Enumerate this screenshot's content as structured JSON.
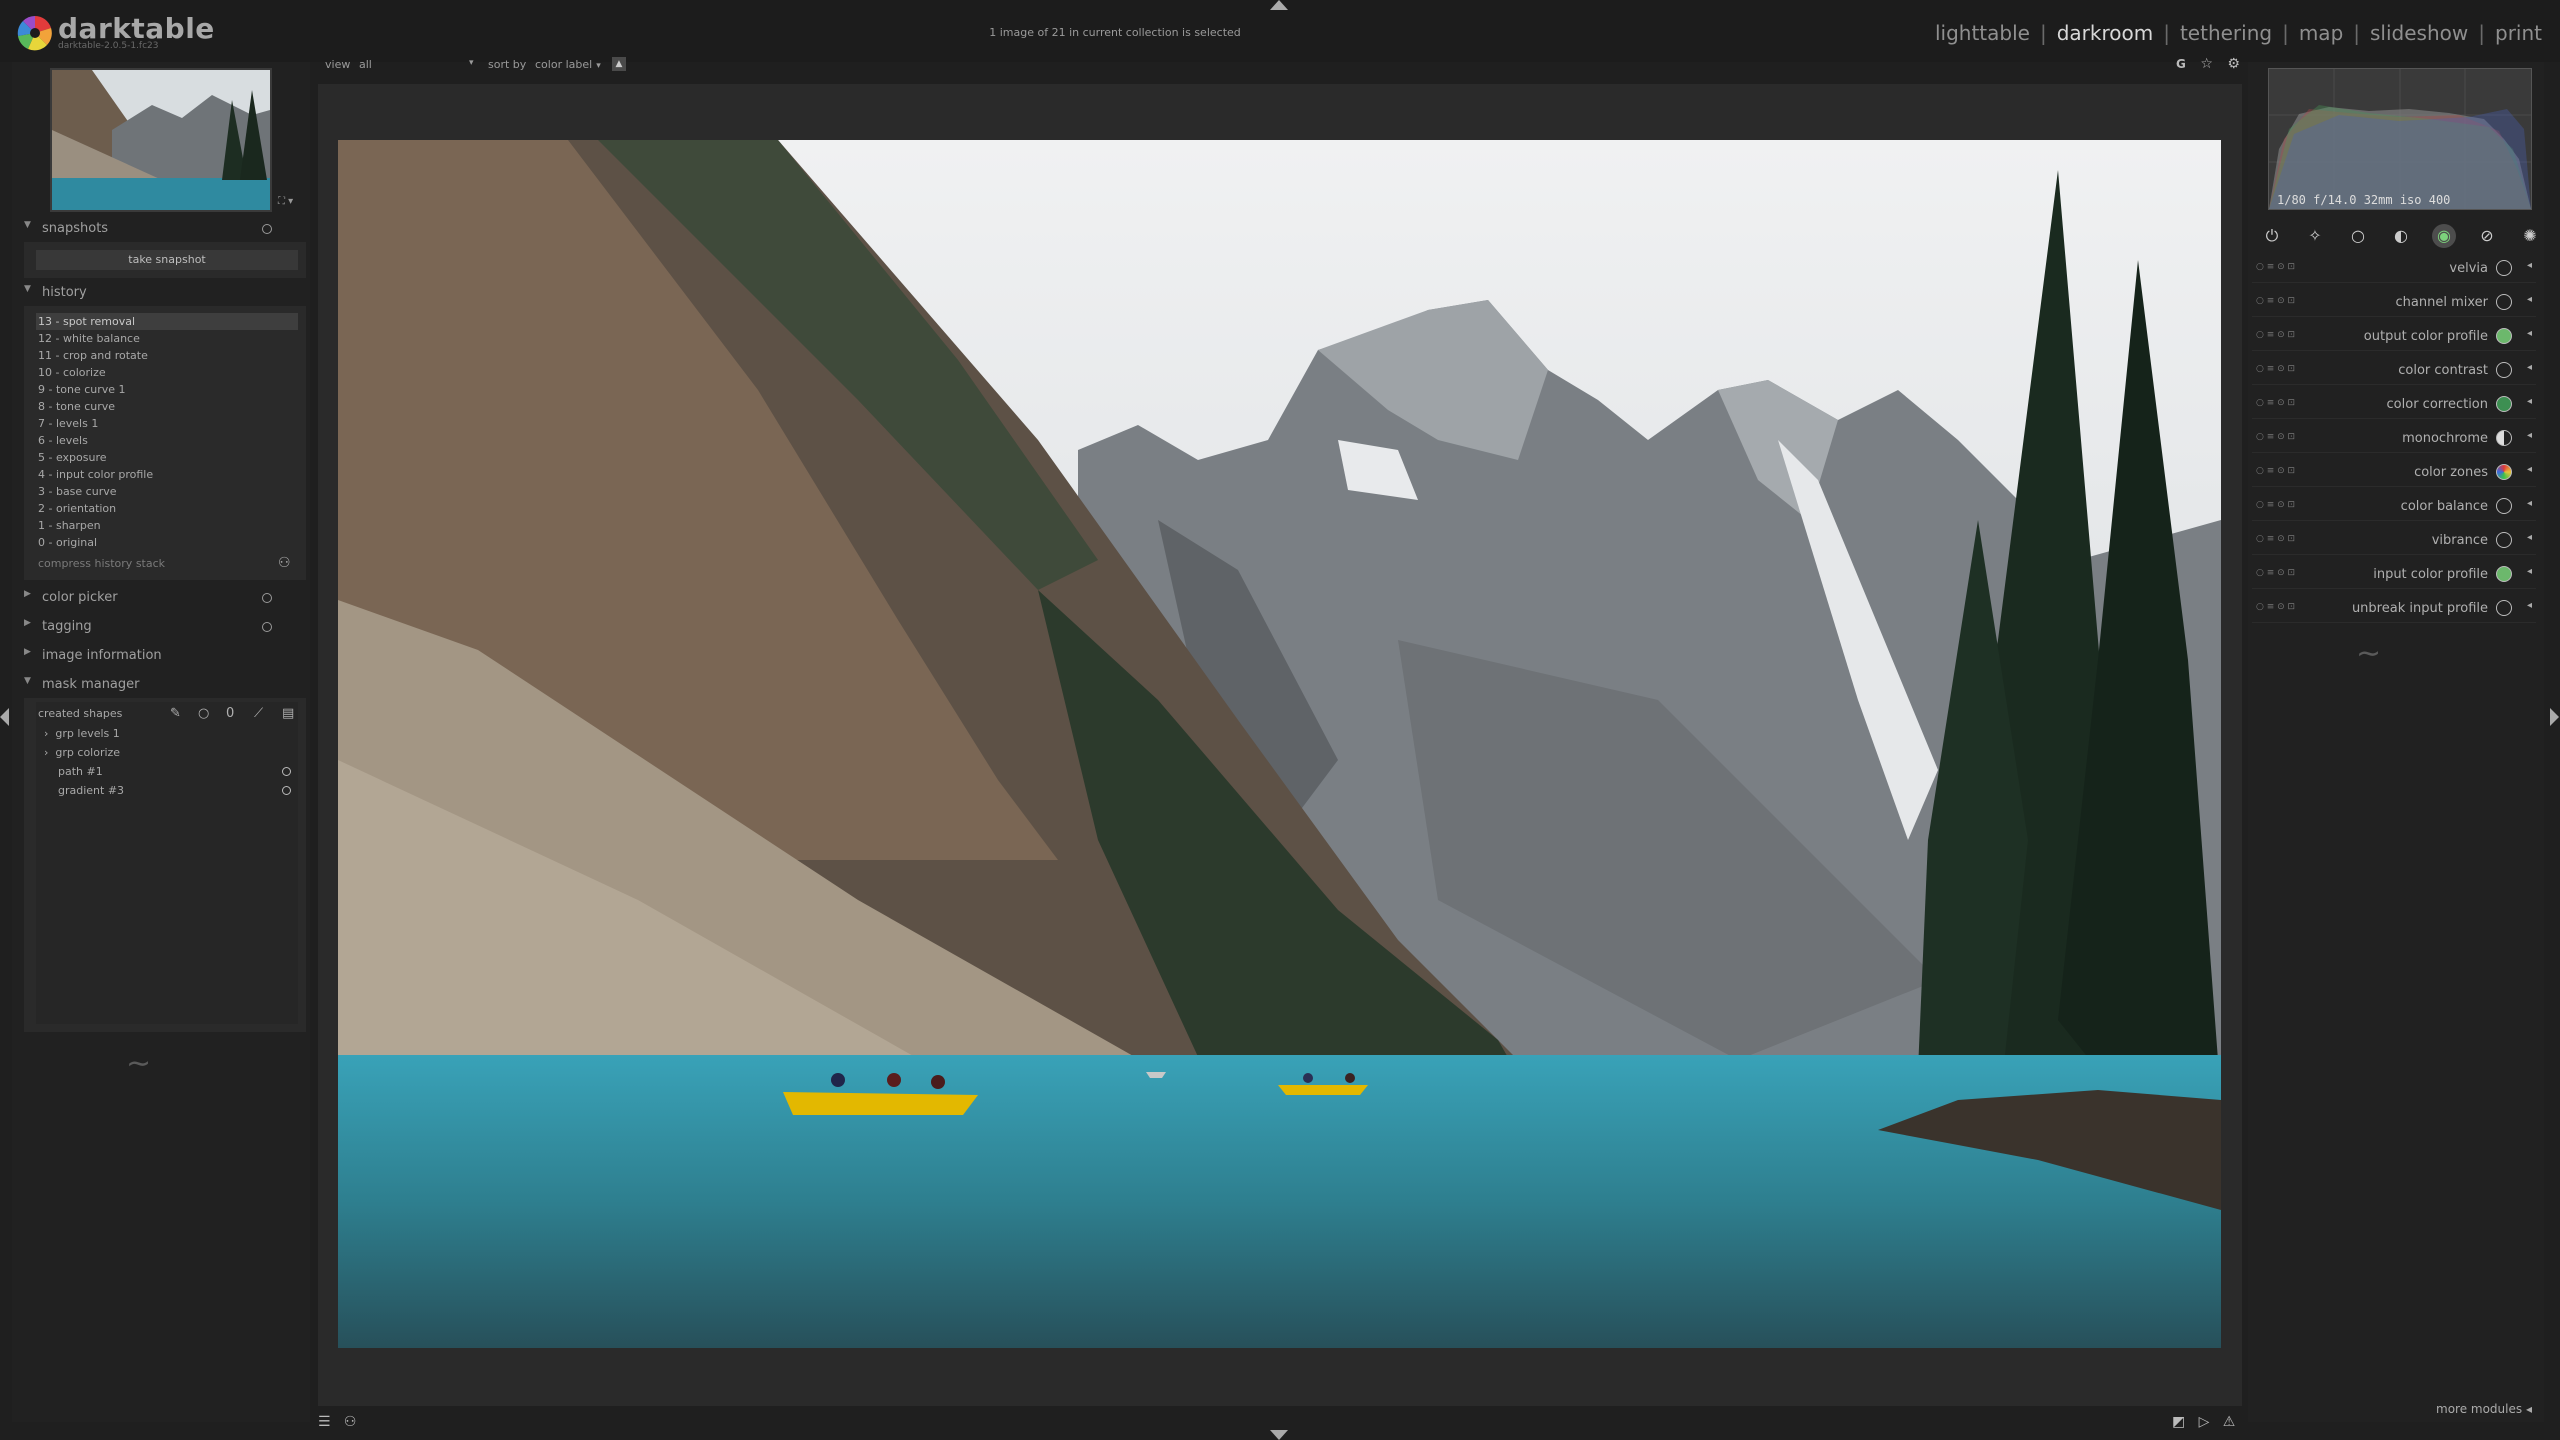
{
  "header": {
    "app_name": "darktable",
    "app_version": "darktable-2.0.5-1.fc23",
    "status": "1 image of 21 in current collection is selected",
    "views": [
      "lighttable",
      "darkroom",
      "tethering",
      "map",
      "slideshow",
      "print"
    ],
    "active_view": "darkroom"
  },
  "toolbar": {
    "view_label": "view",
    "view_value": "all",
    "sort_label": "sort by",
    "sort_value": "color label",
    "right_icons": [
      "grouping-icon",
      "overlay-star-icon",
      "preferences-gear-icon"
    ]
  },
  "left_panel": {
    "snapshots": {
      "title": "snapshots",
      "take_snapshot": "take snapshot"
    },
    "history": {
      "title": "history",
      "items": [
        "13 - spot removal",
        "12 - white balance",
        "11 - crop and rotate",
        "10 - colorize",
        "9 - tone curve 1",
        "8 - tone curve",
        "7 - levels 1",
        "6 - levels",
        "5 - exposure",
        "4 - input color profile",
        "3 - base curve",
        "2 - orientation",
        "1 - sharpen",
        "0 - original"
      ],
      "selected_index": 0,
      "compress": "compress history stack"
    },
    "color_picker": {
      "title": "color picker"
    },
    "tagging": {
      "title": "tagging"
    },
    "image_information": {
      "title": "image information"
    },
    "mask_manager": {
      "title": "mask manager",
      "created_shapes": "created shapes",
      "shapes": [
        "grp levels 1",
        "grp colorize",
        "path #1",
        "gradient #3"
      ]
    }
  },
  "right_panel": {
    "histogram_info": "1/80 f/14.0 32mm iso 400",
    "module_groups": [
      "power-icon",
      "favorite-icon",
      "basic-group-icon",
      "tone-group-icon",
      "color-group-icon",
      "correct-group-icon",
      "effect-group-icon"
    ],
    "active_group_index": 4,
    "modules": [
      {
        "name": "velvia",
        "icon": "velvia-icon"
      },
      {
        "name": "channel mixer",
        "icon": "channel-mixer-icon"
      },
      {
        "name": "output color profile",
        "icon": "output-color-profile-icon"
      },
      {
        "name": "color contrast",
        "icon": "color-contrast-icon"
      },
      {
        "name": "color correction",
        "icon": "color-correction-icon"
      },
      {
        "name": "monochrome",
        "icon": "monochrome-icon"
      },
      {
        "name": "color zones",
        "icon": "color-zones-icon"
      },
      {
        "name": "color balance",
        "icon": "color-balance-icon"
      },
      {
        "name": "vibrance",
        "icon": "vibrance-icon"
      },
      {
        "name": "input color profile",
        "icon": "input-color-profile-icon"
      },
      {
        "name": "unbreak input profile",
        "icon": "unbreak-input-profile-icon"
      }
    ],
    "more_modules": "more modules"
  },
  "colors": {
    "background": "#1f1f1f",
    "panel": "#212121",
    "center": "#2a2a2a",
    "active_group": "#4d4d4d",
    "lake": "#2c8ca0",
    "canoe": "#e3b800"
  }
}
